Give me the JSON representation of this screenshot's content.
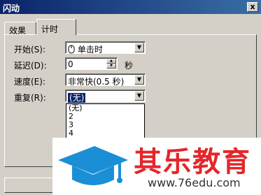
{
  "window": {
    "title": "闪动",
    "close_label": "x"
  },
  "tabs": [
    {
      "label": "效果"
    },
    {
      "label": "计时"
    }
  ],
  "form": {
    "start": {
      "label": "开始(S):",
      "value": "单击时"
    },
    "delay": {
      "label": "延迟(D):",
      "value": "0",
      "unit": "秒"
    },
    "speed": {
      "label": "速度(E):",
      "value": "非常快(0.5 秒)"
    },
    "repeat": {
      "label": "重复(R):",
      "value": "(无)",
      "options": [
        "(无)",
        "2",
        "3",
        "4"
      ]
    }
  },
  "watermark": {
    "brand": "其乐教育",
    "url": "www.76edu.com"
  },
  "colors": {
    "title_bar": "#0a246a",
    "brand_red": "#e4262a",
    "logo_blue": "#1a8fd6"
  }
}
